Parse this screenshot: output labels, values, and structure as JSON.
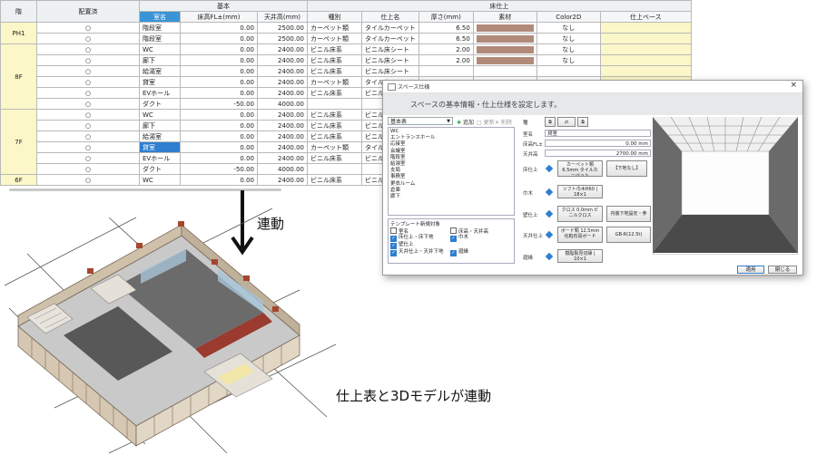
{
  "sheet": {
    "group_headers": {
      "floor": "階",
      "placement": "配置済",
      "basic": "基本",
      "floor_finish": "床仕上"
    },
    "col_headers": {
      "room_name": "室名",
      "floor_fl": "床高FL±(mm)",
      "ceiling": "天井高(mm)",
      "kind": "種別",
      "finish_name": "仕上名",
      "thickness": "厚さ(mm)",
      "material": "素材",
      "color2d": "Color2D",
      "finish_base": "仕上ベース"
    },
    "floors": [
      {
        "label": "PH1",
        "rows": [
          {
            "check": "○",
            "room": "階段室",
            "fl": "0.00",
            "ceil": "2500.00",
            "kind": "カーペット類",
            "finish": "タイルカーペット",
            "thick": "6.50",
            "swatch": true,
            "color": "なし"
          },
          {
            "check": "○",
            "room": "階段室",
            "fl": "0.00",
            "ceil": "2500.00",
            "kind": "カーペット類",
            "finish": "タイルカーペット",
            "thick": "6.50",
            "swatch": true,
            "color": "なし"
          }
        ]
      },
      {
        "label": "8F",
        "rows": [
          {
            "check": "○",
            "room": "WC",
            "fl": "0.00",
            "ceil": "2400.00",
            "kind": "ビニル床系",
            "finish": "ビニル床シート",
            "thick": "2.00",
            "swatch": true,
            "color": "なし"
          },
          {
            "check": "○",
            "room": "廊下",
            "fl": "0.00",
            "ceil": "2400.00",
            "kind": "ビニル床系",
            "finish": "ビニル床シート",
            "thick": "2.00",
            "swatch": true,
            "color": "なし"
          },
          {
            "check": "○",
            "room": "給湯室",
            "fl": "0.00",
            "ceil": "2400.00",
            "kind": "ビニル床系",
            "finish": "ビニル床シート",
            "thick": "",
            "swatch": false,
            "color": ""
          },
          {
            "check": "○",
            "room": "貸室",
            "fl": "0.00",
            "ceil": "2400.00",
            "kind": "カーペット類",
            "finish": "タイルカーペット",
            "thick": "",
            "swatch": false,
            "color": ""
          },
          {
            "check": "○",
            "room": "EVホール",
            "fl": "0.00",
            "ceil": "2400.00",
            "kind": "ビニル床系",
            "finish": "ビニル床シート",
            "thick": "",
            "swatch": false,
            "color": ""
          },
          {
            "check": "○",
            "room": "ダクト",
            "fl": "-50.00",
            "ceil": "4000.00",
            "kind": "",
            "finish": "",
            "thick": "",
            "swatch": false,
            "color": ""
          }
        ]
      },
      {
        "label": "7F",
        "rows": [
          {
            "check": "○",
            "room": "WC",
            "fl": "0.00",
            "ceil": "2400.00",
            "kind": "ビニル床系",
            "finish": "ビニル床シート",
            "thick": "",
            "swatch": false,
            "color": ""
          },
          {
            "check": "○",
            "room": "廊下",
            "fl": "0.00",
            "ceil": "2400.00",
            "kind": "ビニル床系",
            "finish": "ビニル床シート",
            "thick": "",
            "swatch": false,
            "color": ""
          },
          {
            "check": "○",
            "room": "給湯室",
            "fl": "0.00",
            "ceil": "2400.00",
            "kind": "ビニル床系",
            "finish": "ビニル床シート",
            "thick": "",
            "swatch": false,
            "color": ""
          },
          {
            "check": "○",
            "room": "貸室",
            "fl": "0.00",
            "ceil": "2400.00",
            "kind": "カーペット類",
            "finish": "タイルカーペット",
            "thick": "",
            "swatch": false,
            "color": "",
            "selected": true
          },
          {
            "check": "○",
            "room": "EVホール",
            "fl": "0.00",
            "ceil": "2400.00",
            "kind": "ビニル床系",
            "finish": "ビニル床シート",
            "thick": "",
            "swatch": false,
            "color": ""
          },
          {
            "check": "○",
            "room": "ダクト",
            "fl": "-50.00",
            "ceil": "4000.00",
            "kind": "",
            "finish": "",
            "thick": "",
            "swatch": false,
            "color": ""
          }
        ]
      },
      {
        "label": "6F",
        "rows": [
          {
            "check": "○",
            "room": "WC",
            "fl": "0.00",
            "ceil": "2400.00",
            "kind": "ビニル床系",
            "finish": "ビニル床シート",
            "thick": "",
            "swatch": false,
            "color": ""
          }
        ]
      }
    ]
  },
  "captions": {
    "link": "連動",
    "bottom": "仕上表と3Dモデルが連動"
  },
  "dialog": {
    "title": "スペース仕様",
    "close": "×",
    "banner": "スペースの基本情報・仕上仕様を設定します。",
    "filter_value": "基本表",
    "list_buttons": {
      "add": "追加",
      "update": "更新",
      "delete": "削除"
    },
    "spaces": [
      "WC",
      "エントランスホール",
      "応接室",
      "会議室",
      "階段室",
      "給湯室",
      "支局",
      "事務室",
      "更衣ルーム",
      "倉庫",
      "廊下"
    ],
    "template_title": "テンプレート新規対象",
    "template_opts": [
      {
        "label": "室名",
        "on": false
      },
      {
        "label": "床高・天井高",
        "on": false
      },
      {
        "label": "床仕上・床下地",
        "on": true
      },
      {
        "label": "巾木",
        "on": true
      },
      {
        "label": "壁仕上",
        "on": true
      },
      {
        "label": "天井仕上・天井下地",
        "on": true
      },
      {
        "label": "廻縁",
        "on": true
      }
    ],
    "form": {
      "top_label": "種",
      "room_name_label": "室名",
      "room_name": "貸室",
      "floor_fl_label": "床高FL±",
      "floor_fl": "0.00  mm",
      "ceiling_label": "天井高",
      "ceiling": "2700.00  mm",
      "floor_finish_label": "床仕上",
      "floor_finish_btn": "カーペット類 6.5mm タイルカーペット",
      "floor_base_btn": "【下地なし】",
      "skirting_label": "巾木",
      "skirting_btn": "ソフト巾木H60 | 18×1",
      "wall_label": "壁仕上",
      "wall_btn": "クロス 0.0mm ビニルクロス",
      "wall_base_btn": "内装下地設定・参照",
      "ceiling_finish_label": "天井仕上",
      "ceiling_finish_btn": "ボード類 12.5mm 化粧石膏ボード",
      "ceiling_base_btn": "GB-R(12.5t)",
      "molding_label": "廻縁",
      "molding_btn": "樹脂製見切縁 | 10×1"
    },
    "footer": {
      "apply": "適用",
      "close": "閉じる"
    }
  }
}
